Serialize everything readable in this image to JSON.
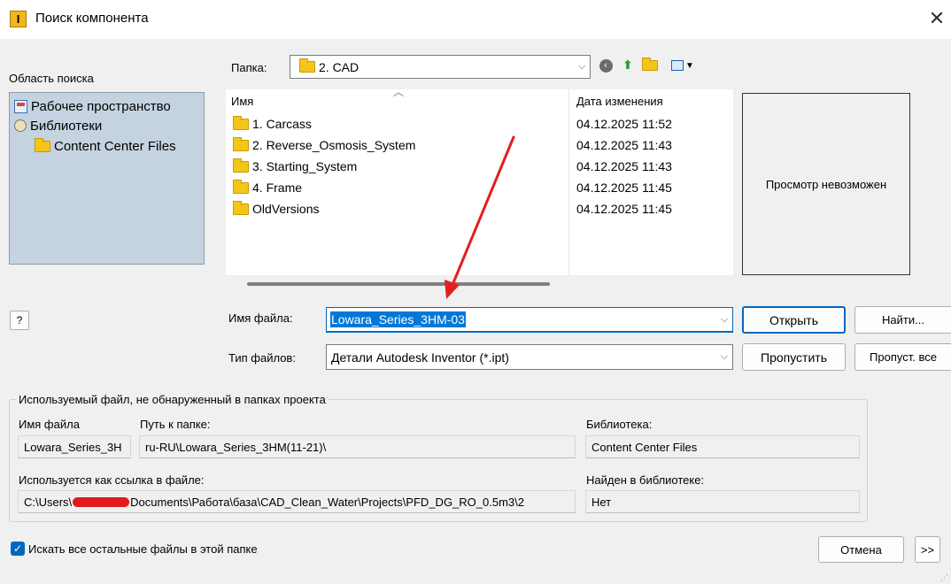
{
  "window": {
    "title": "Поиск компонента",
    "app_icon_letter": "I"
  },
  "scope": {
    "label": "Область поиска",
    "items": [
      {
        "label": "Рабочее пространство",
        "icon": "workspace-icon"
      },
      {
        "label": "Библиотеки",
        "icon": "libraries-icon"
      },
      {
        "label": "Content Center Files",
        "icon": "folder-icon"
      }
    ]
  },
  "folder": {
    "label": "Папка:",
    "value": "2. CAD"
  },
  "filelist": {
    "col_name": "Имя",
    "col_date": "Дата изменения",
    "rows": [
      {
        "name": "1. Carcass",
        "date": "04.12.2025 11:52"
      },
      {
        "name": "2. Reverse_Osmosis_System",
        "date": "04.12.2025 11:43"
      },
      {
        "name": "3. Starting_System",
        "date": "04.12.2025 11:43"
      },
      {
        "name": "4. Frame",
        "date": "04.12.2025 11:45"
      },
      {
        "name": "OldVersions",
        "date": "04.12.2025 11:45"
      }
    ]
  },
  "preview": {
    "text": "Просмотр невозможен"
  },
  "filename": {
    "label": "Имя файла:",
    "value": "Lowara_Series_3HM-03"
  },
  "filetype": {
    "label": "Тип файлов:",
    "value": "Детали Autodesk Inventor (*.ipt)"
  },
  "buttons": {
    "open": "Открыть",
    "find": "Найти...",
    "skip": "Пропустить",
    "skip_all": "Пропуст. все",
    "cancel": "Отмена",
    "more": ">>"
  },
  "unresolved": {
    "title": "Используемый файл, не обнаруженный в папках проекта",
    "filename_label": "Имя файла",
    "filename_value": "Lowara_Series_3H",
    "path_label": "Путь к папке:",
    "path_value": "ru-RU\\Lowara_Series_3HM(11-21)\\",
    "library_label": "Библиотека:",
    "library_value": "Content Center Files",
    "referenced_label": "Используется как ссылка в файле:",
    "referenced_value": "C:\\Users\\",
    "referenced_value_tail": "Documents\\Работа\\база\\CAD_Clean_Water\\Projects\\PFD_DG_RO_0.5m3\\2",
    "found_label": "Найден в библиотеке:",
    "found_value": "Нет"
  },
  "search_all": {
    "label": "Искать все остальные файлы в этой папке",
    "checked": true
  },
  "colors": {
    "scope_bg": "#c5d3e1",
    "accent": "#0067c0",
    "selection": "#0078d7",
    "annotation_arrow": "#e02020"
  }
}
